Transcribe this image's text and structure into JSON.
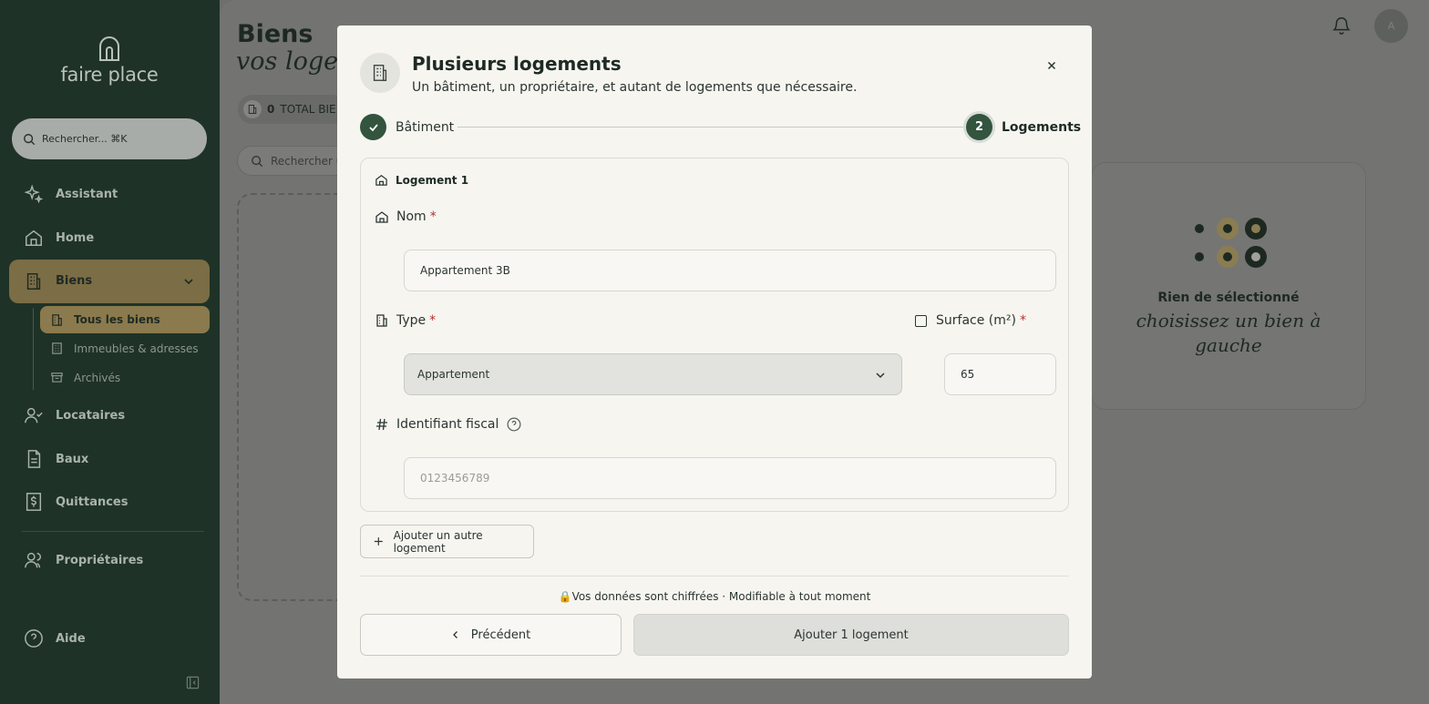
{
  "sidebar": {
    "brand": "faire place",
    "search_placeholder": "Rechercher... ⌘K",
    "items": {
      "assistant": "Assistant",
      "home": "Home",
      "biens": "Biens",
      "tous_les_biens": "Tous les biens",
      "immeubles": "Immeubles & adresses",
      "archives": "Archivés",
      "locataires": "Locataires",
      "baux": "Baux",
      "quittances": "Quittances",
      "proprietaires": "Propriétaires",
      "aide": "Aide"
    }
  },
  "main": {
    "title": "Biens",
    "subtitle": "vos loge",
    "count_value": "0",
    "count_label": "TOTAL BIE",
    "search_placeholder": "Rechercher u",
    "empty_title": "Rien de sélectionné",
    "empty_subtitle": "choisissez un bien à gauche",
    "avatar_initial": "A"
  },
  "modal": {
    "title": "Plusieurs logements",
    "subtitle": "Un bâtiment, un propriétaire, et autant de logements que nécessaire.",
    "close_symbol": "×",
    "steps": [
      {
        "label": "Bâtiment",
        "status": "done"
      },
      {
        "number": "2",
        "label": "Logements",
        "status": "active"
      }
    ],
    "card_title": "Logement 1",
    "fields": {
      "nom_label": "Nom",
      "nom_value": "Appartement 3B",
      "type_label": "Type",
      "type_value": "Appartement",
      "surface_label": "Surface (m²)",
      "surface_value": "65",
      "fiscal_label": "Identifiant fiscal",
      "fiscal_placeholder": "0123456789",
      "required_mark": "*"
    },
    "add_button": "Ajouter un autre logement",
    "security_note": "🔒Vos données sont chiffrées · Modifiable à tout moment",
    "prev_button": "Précédent",
    "submit_button": "Ajouter 1 logement"
  },
  "colors": {
    "sidebar_bg": "#1f3227",
    "accent_green": "#33543f",
    "accent_gold": "#7b6d45",
    "required_red": "#b3322f"
  }
}
